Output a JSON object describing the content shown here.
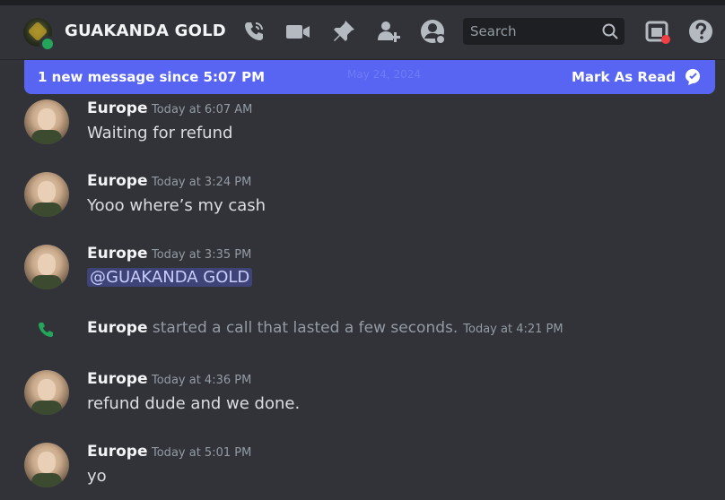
{
  "header": {
    "channel_name": "GUAKANDA GOLD",
    "icons": [
      "call-icon",
      "video-icon",
      "pin-icon",
      "add-member-icon",
      "profile-icon",
      "inbox-icon",
      "help-icon"
    ],
    "search": {
      "placeholder": "Search"
    }
  },
  "banner": {
    "text": "1 new message since 5:07 PM",
    "date_ghost": "May 24, 2024",
    "action_label": "Mark As Read",
    "color": "#5865f2"
  },
  "messages": [
    {
      "author": "Europe",
      "timestamp": "Today at 6:07 AM",
      "text": "Waiting for refund"
    },
    {
      "author": "Europe",
      "timestamp": "Today at 3:24 PM",
      "text": "Yooo where’s my cash"
    },
    {
      "author": "Europe",
      "timestamp": "Today at 3:35 PM",
      "mention": "@GUAKANDA GOLD"
    },
    {
      "type": "call",
      "author": "Europe",
      "text": "started a call that lasted a few seconds.",
      "timestamp": "Today at 4:21 PM"
    },
    {
      "author": "Europe",
      "timestamp": "Today at 4:36 PM",
      "text": "refund dude and we done."
    },
    {
      "author": "Europe",
      "timestamp": "Today at 5:01 PM",
      "text": "yo"
    }
  ],
  "colors": {
    "background": "#313338",
    "status_online": "#23a55a",
    "call_green": "#23a55a",
    "inbox_badge": "#f23f43"
  }
}
